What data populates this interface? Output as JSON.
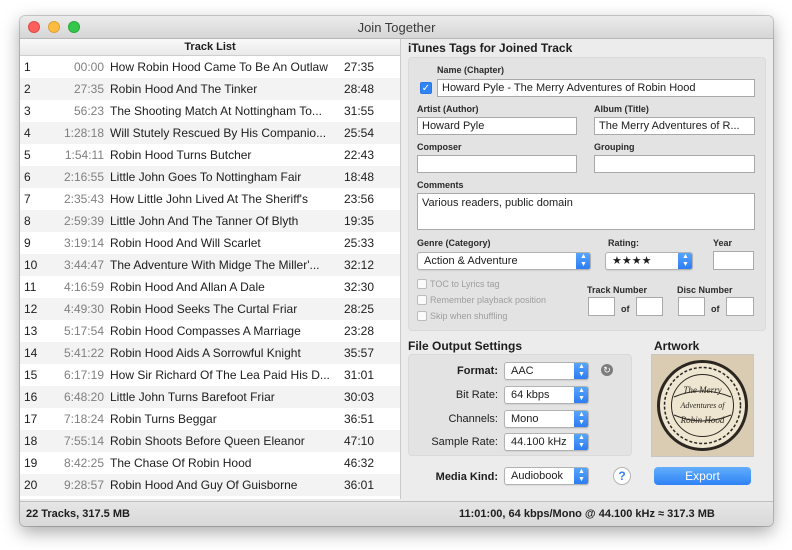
{
  "window": {
    "title": "Join Together"
  },
  "track_list": {
    "header": "Track List",
    "rows": [
      {
        "num": "1",
        "start": "00:00",
        "title": "How Robin Hood Came To Be An Outlaw",
        "duration": "27:35"
      },
      {
        "num": "2",
        "start": "27:35",
        "title": "Robin Hood And The Tinker",
        "duration": "28:48"
      },
      {
        "num": "3",
        "start": "56:23",
        "title": "The Shooting Match At Nottingham To...",
        "duration": "31:55"
      },
      {
        "num": "4",
        "start": "1:28:18",
        "title": "Will Stutely Rescued By His Companio...",
        "duration": "25:54"
      },
      {
        "num": "5",
        "start": "1:54:11",
        "title": "Robin Hood Turns Butcher",
        "duration": "22:43"
      },
      {
        "num": "6",
        "start": "2:16:55",
        "title": "Little John Goes To Nottingham Fair",
        "duration": "18:48"
      },
      {
        "num": "7",
        "start": "2:35:43",
        "title": "How Little John Lived At The Sheriff's",
        "duration": "23:56"
      },
      {
        "num": "8",
        "start": "2:59:39",
        "title": "Little John And The Tanner Of Blyth",
        "duration": "19:35"
      },
      {
        "num": "9",
        "start": "3:19:14",
        "title": "Robin Hood And Will Scarlet",
        "duration": "25:33"
      },
      {
        "num": "10",
        "start": "3:44:47",
        "title": "The Adventure With Midge The Miller'...",
        "duration": "32:12"
      },
      {
        "num": "11",
        "start": "4:16:59",
        "title": "Robin Hood And Allan A Dale",
        "duration": "32:30"
      },
      {
        "num": "12",
        "start": "4:49:30",
        "title": "Robin Hood Seeks The Curtal Friar",
        "duration": "28:25"
      },
      {
        "num": "13",
        "start": "5:17:54",
        "title": "Robin Hood Compasses A Marriage",
        "duration": "23:28"
      },
      {
        "num": "14",
        "start": "5:41:22",
        "title": "Robin Hood Aids A Sorrowful Knight",
        "duration": "35:57"
      },
      {
        "num": "15",
        "start": "6:17:19",
        "title": "How Sir Richard Of The Lea Paid His D...",
        "duration": "31:01"
      },
      {
        "num": "16",
        "start": "6:48:20",
        "title": "Little John Turns Barefoot Friar",
        "duration": "30:03"
      },
      {
        "num": "17",
        "start": "7:18:24",
        "title": "Robin Turns Beggar",
        "duration": "36:51"
      },
      {
        "num": "18",
        "start": "7:55:14",
        "title": "Robin Shoots Before Queen Eleanor",
        "duration": "47:10"
      },
      {
        "num": "19",
        "start": "8:42:25",
        "title": "The Chase Of Robin Hood",
        "duration": "46:32"
      },
      {
        "num": "20",
        "start": "9:28:57",
        "title": "Robin Hood And Guy Of Guisborne",
        "duration": "36:01"
      }
    ]
  },
  "tags": {
    "section_title": "iTunes Tags for Joined Track",
    "name_label": "Name (Chapter)",
    "name_value": "Howard Pyle - The Merry Adventures of Robin Hood",
    "name_checked": true,
    "artist_label": "Artist (Author)",
    "artist_value": "Howard Pyle",
    "album_label": "Album (Title)",
    "album_value": "The Merry Adventures of R...",
    "composer_label": "Composer",
    "composer_value": "",
    "grouping_label": "Grouping",
    "grouping_value": "",
    "comments_label": "Comments",
    "comments_value": "Various readers, public domain",
    "genre_label": "Genre (Category)",
    "genre_value": "Action & Adventure",
    "rating_label": "Rating:",
    "rating_value": "★★★★",
    "year_label": "Year",
    "year_value": "",
    "toc_label": "TOC to Lyrics tag",
    "remember_label": "Remember playback position",
    "skip_label": "Skip when shuffling",
    "track_number_label": "Track Number",
    "disc_number_label": "Disc Number",
    "of_label": "of"
  },
  "output": {
    "section_title": "File Output Settings",
    "format_label": "Format:",
    "format_value": "AAC",
    "bitrate_label": "Bit Rate:",
    "bitrate_value": "64 kbps",
    "channels_label": "Channels:",
    "channels_value": "Mono",
    "samplerate_label": "Sample Rate:",
    "samplerate_value": "44.100 kHz",
    "mediakind_label": "Media Kind:",
    "mediakind_value": "Audiobook"
  },
  "artwork": {
    "label": "Artwork",
    "text_line1": "The Merry",
    "text_line2": "Adventures of",
    "text_line3": "Robin Hood"
  },
  "buttons": {
    "export": "Export",
    "help": "?"
  },
  "status": {
    "left": "22 Tracks, 317.5 MB",
    "right": "11:01:00, 64 kbps/Mono @ 44.100 kHz ≈ 317.3 MB"
  }
}
